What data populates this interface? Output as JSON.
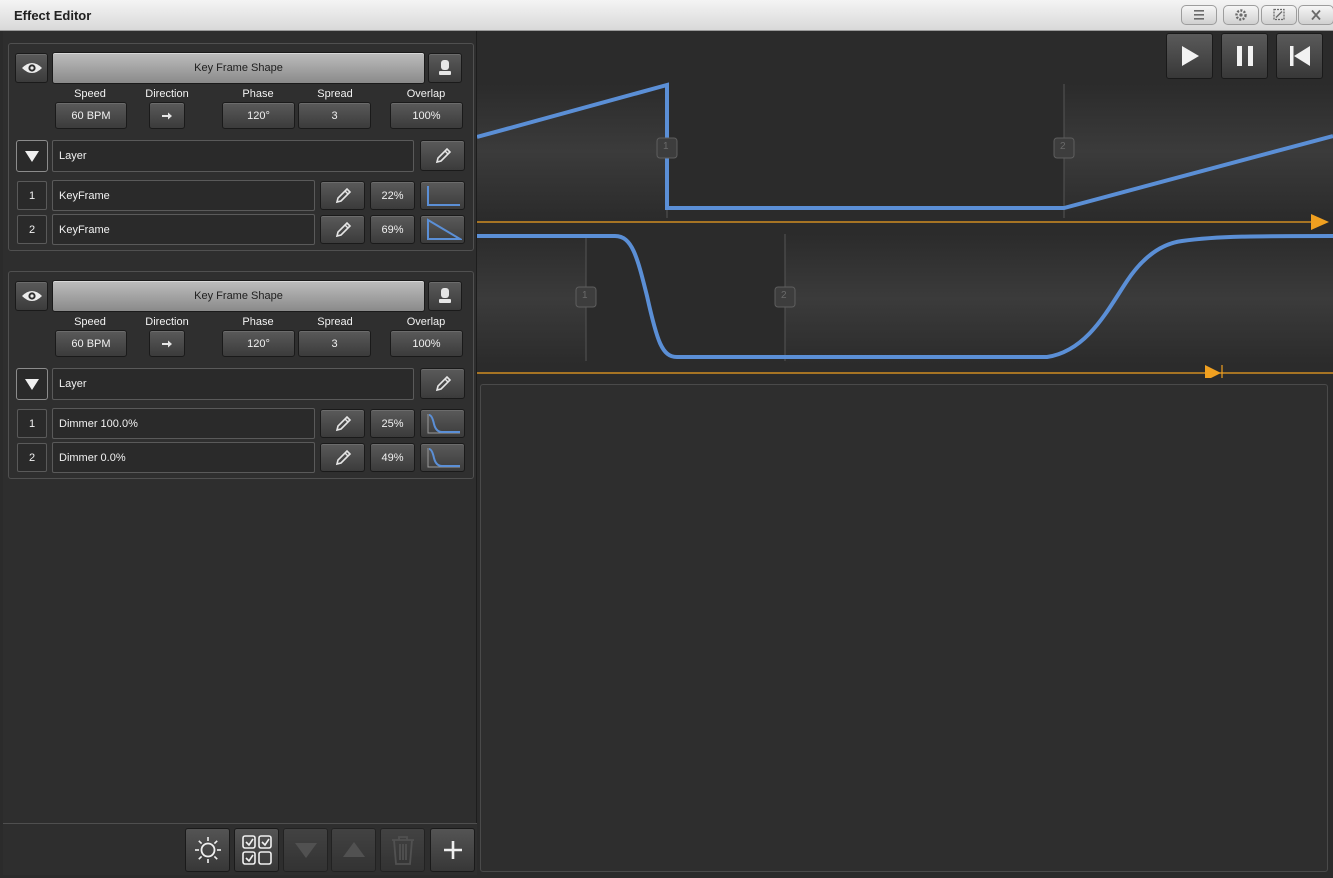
{
  "window": {
    "title": "Effect Editor",
    "buttons": [
      "menu-icon",
      "gear-icon",
      "maximize-icon",
      "close-icon"
    ]
  },
  "colors": {
    "curve": "#5b8fd6",
    "playhead": "#f0a020"
  },
  "layers": [
    {
      "shape_button": "Key Frame Shape",
      "params": {
        "speed_label": "Speed",
        "speed": "60 BPM",
        "direction_label": "Direction",
        "phase_label": "Phase",
        "phase": "120°",
        "spread_label": "Spread",
        "spread": "3",
        "overlap_label": "Overlap",
        "overlap": "100%"
      },
      "layer_name": "Layer",
      "keyframes": [
        {
          "index": "1",
          "name": "KeyFrame",
          "percent": "22%",
          "curve_icon": "step-curve-icon"
        },
        {
          "index": "2",
          "name": "KeyFrame",
          "percent": "69%",
          "curve_icon": "linear-down-curve-icon"
        }
      ]
    },
    {
      "shape_button": "Key Frame Shape",
      "params": {
        "speed_label": "Speed",
        "speed": "60 BPM",
        "direction_label": "Direction",
        "phase_label": "Phase",
        "phase": "120°",
        "spread_label": "Spread",
        "spread": "3",
        "overlap_label": "Overlap",
        "overlap": "100%"
      },
      "layer_name": "Layer",
      "keyframes": [
        {
          "index": "1",
          "name": "Dimmer 100.0%",
          "percent": "25%",
          "curve_icon": "s-curve-icon"
        },
        {
          "index": "2",
          "name": "Dimmer 0.0%",
          "percent": "49%",
          "curve_icon": "s-curve-icon"
        }
      ]
    }
  ],
  "graph": {
    "top_markers": [
      "1",
      "2"
    ],
    "bottom_markers": [
      "1",
      "2"
    ]
  },
  "toolbar_icons": [
    "brightness-icon",
    "select-all-icon",
    "move-down-icon",
    "move-up-icon",
    "delete-icon",
    "add-icon"
  ],
  "transport_icons": [
    "play-icon",
    "pause-icon",
    "rewind-icon"
  ]
}
